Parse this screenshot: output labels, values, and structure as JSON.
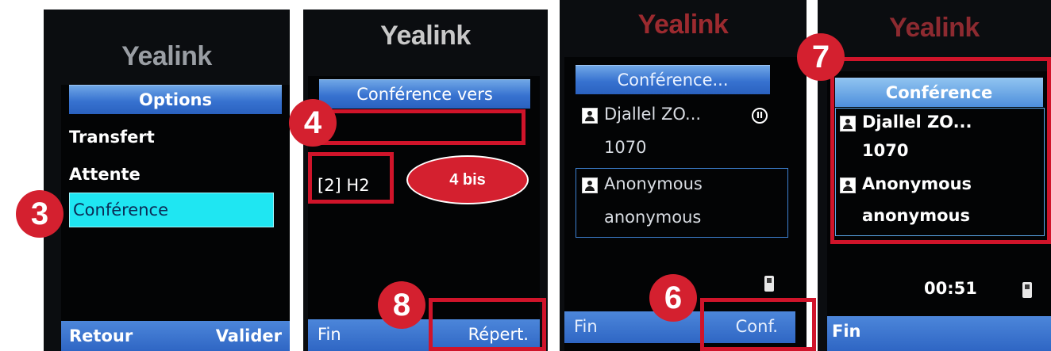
{
  "panels": [
    {
      "logo": "Yealink",
      "title": "Options",
      "menu": [
        "Transfert",
        "Attente",
        "Conférence"
      ],
      "softkeys": {
        "left": "Retour",
        "right": "Valider"
      },
      "badge": "3"
    },
    {
      "logo": "Yealink",
      "title": "Conférence vers",
      "input_value": "",
      "result": "[2] H2",
      "softkeys": {
        "left": "Fin",
        "right": "Répert."
      },
      "badges": [
        "4",
        "8"
      ],
      "bis_label": "4 bis"
    },
    {
      "logo": "Yealink",
      "title": "Conférence...",
      "calls": [
        {
          "name": "Djallel ZO...",
          "number": "1070"
        },
        {
          "name": "Anonymous",
          "number": "anonymous"
        }
      ],
      "softkeys": {
        "left": "Fin",
        "right": "Conf."
      },
      "badge": "6"
    },
    {
      "logo": "Yealink",
      "title": "Conférence",
      "calls": [
        {
          "name": "Djallel ZO...",
          "number": "1070"
        },
        {
          "name": "Anonymous",
          "number": "anonymous"
        }
      ],
      "timer": "00:51",
      "softkeys": {
        "left": "Fin"
      },
      "badge": "7"
    }
  ],
  "colors": {
    "annotation_red": "#d4202f",
    "titlebar_blue": "#3772d0",
    "selection_cyan": "#1fe6f2",
    "logo_text": "#cfcfcf"
  },
  "icons": [
    "contact-icon",
    "hold-icon",
    "phone-icon"
  ]
}
